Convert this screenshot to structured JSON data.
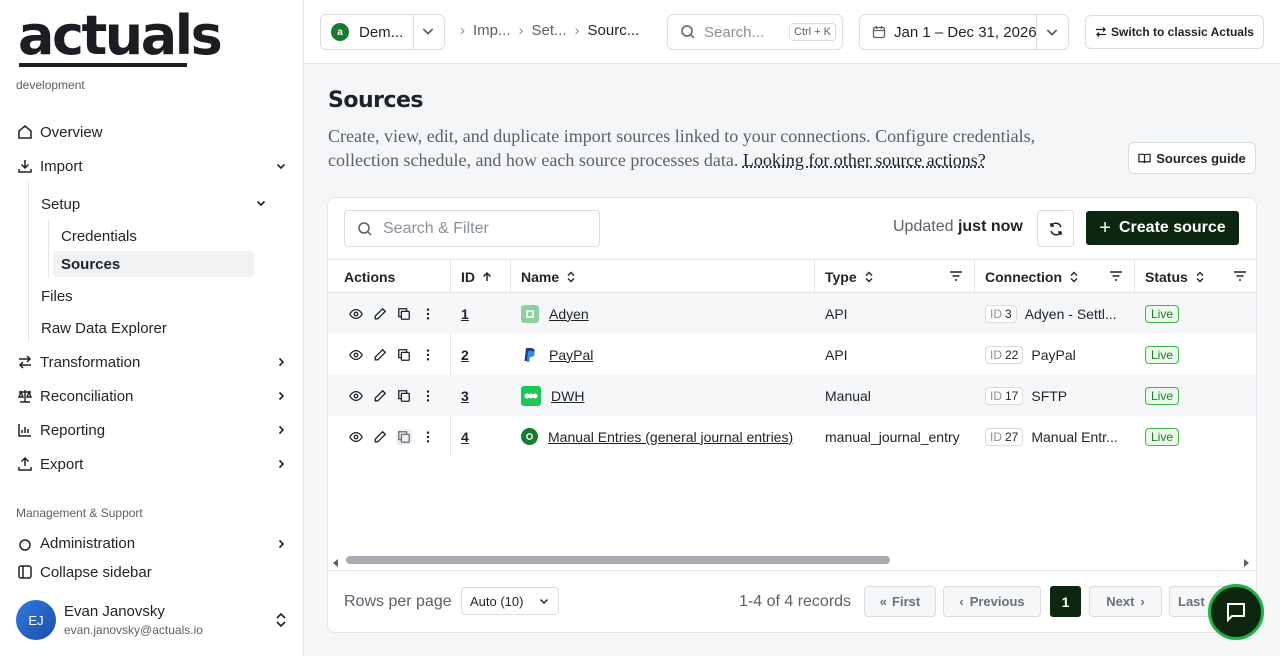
{
  "brand": {
    "logo_text": "actuals",
    "environment": "development"
  },
  "sidebar": {
    "nav": [
      {
        "label": "Overview"
      },
      {
        "label": "Import"
      },
      {
        "label": "Transformation"
      },
      {
        "label": "Reconciliation"
      },
      {
        "label": "Reporting"
      },
      {
        "label": "Export"
      }
    ],
    "import_children": {
      "setup": "Setup",
      "credentials": "Credentials",
      "sources": "Sources",
      "files": "Files",
      "raw_data_explorer": "Raw Data Explorer"
    },
    "section_label": "Management & Support",
    "administration": "Administration",
    "collapse": "Collapse sidebar",
    "user": {
      "initials": "EJ",
      "name": "Evan Janovsky",
      "email": "evan.janovsky@actuals.io"
    }
  },
  "topbar": {
    "workspace": "Dem...",
    "breadcrumbs": [
      "Imp...",
      "Set...",
      "Sourc..."
    ],
    "search_placeholder": "Search...",
    "search_shortcut": "Ctrl + K",
    "date_range": "Jan 1 – Dec 31, 2026",
    "classic_button": "Switch to classic Actuals"
  },
  "page": {
    "title": "Sources",
    "description": "Create, view, edit, and duplicate import sources linked to your connections. Configure credentials, collection schedule, and how each source processes data.",
    "description_link": "Looking for other source actions?",
    "guide_button": "Sources guide"
  },
  "toolbar": {
    "filter_placeholder": "Search & Filter",
    "updated_prefix": "Updated",
    "updated_value": "just now",
    "create_button": "Create source"
  },
  "table": {
    "columns": [
      "Actions",
      "ID",
      "Name",
      "Type",
      "Connection",
      "Status"
    ],
    "rows": [
      {
        "id": "1",
        "name": "Adyen",
        "type": "API",
        "conn_prefix": "ID",
        "conn_id": "3",
        "connection": "Adyen - Settl...",
        "status": "Live",
        "icon": "adyen-icon"
      },
      {
        "id": "2",
        "name": "PayPal",
        "type": "API",
        "conn_prefix": "ID",
        "conn_id": "22",
        "connection": "PayPal",
        "status": "Live",
        "icon": "paypal-icon"
      },
      {
        "id": "3",
        "name": "DWH",
        "type": "Manual",
        "conn_prefix": "ID",
        "conn_id": "17",
        "connection": "SFTP",
        "status": "Live",
        "icon": "dwh-icon"
      },
      {
        "id": "4",
        "name": "Manual Entries (general journal entries)",
        "type": "manual_journal_entry",
        "conn_prefix": "ID",
        "conn_id": "27",
        "connection": "Manual Entr...",
        "status": "Live",
        "icon": "manual-entries-icon"
      }
    ]
  },
  "pagination": {
    "rows_per_page_label": "Rows per page",
    "rows_per_page_value": "Auto (10)",
    "records": "1-4 of 4 records",
    "first": "First",
    "previous": "Previous",
    "current": "1",
    "next": "Next",
    "last": "Last"
  },
  "colors": {
    "accent_dark": "#0d2610",
    "live_green": "#3fb54a",
    "chat_ring": "#1fb24a"
  }
}
